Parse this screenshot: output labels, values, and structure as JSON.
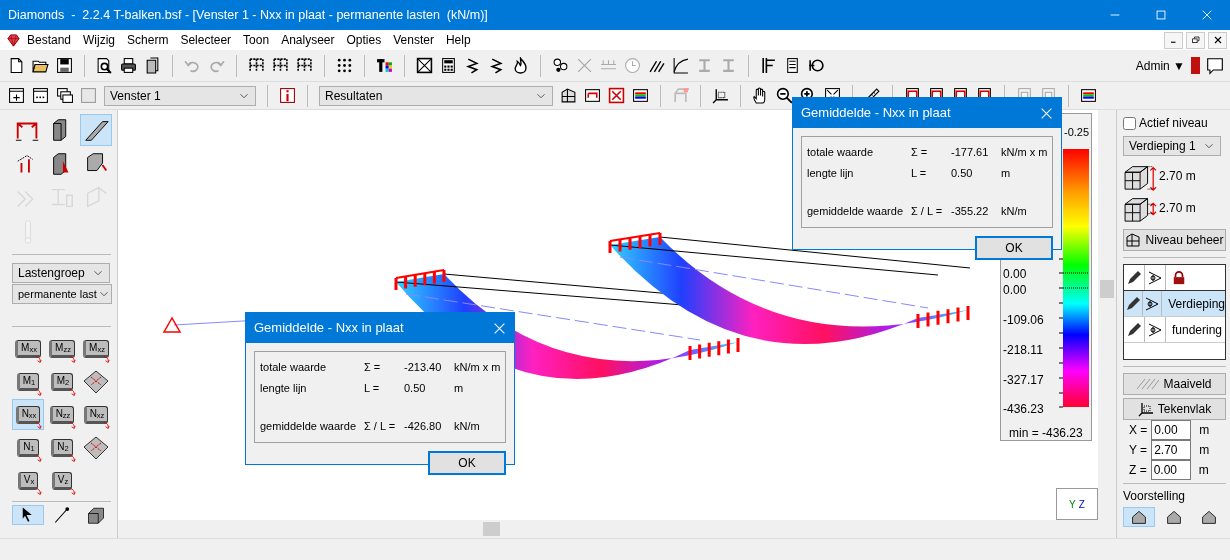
{
  "window": {
    "title": "Diamonds  -  2.2.4 T-balken.bsf - [Venster 1 - Nxx in plaat - permanente lasten  (kN/m)]"
  },
  "menu": [
    {
      "label": "Bestand"
    },
    {
      "label": "Wijzig"
    },
    {
      "label": "Scherm"
    },
    {
      "label": "Selecteer"
    },
    {
      "label": "Toon"
    },
    {
      "label": "Analyseer"
    },
    {
      "label": "Opties"
    },
    {
      "label": "Venster"
    },
    {
      "label": "Help"
    }
  ],
  "user": {
    "name": "Admin",
    "caret": "▼"
  },
  "toolbar": {
    "window_select": "Venster 1",
    "result_select": "Resultaten"
  },
  "left_panel": {
    "tools": [
      {
        "selected": false,
        "disabled": false
      },
      {
        "selected": false,
        "disabled": false
      },
      {
        "selected": true,
        "disabled": false
      },
      {
        "selected": false,
        "disabled": false
      },
      {
        "selected": false,
        "disabled": false
      },
      {
        "selected": false,
        "disabled": false
      },
      {
        "selected": false,
        "disabled": true
      },
      {
        "selected": false,
        "disabled": true
      },
      {
        "selected": false,
        "disabled": true
      },
      {
        "selected": false,
        "disabled": true
      }
    ],
    "load_type": "Lastengroep",
    "load_case": "permanente last",
    "plate_results": [
      {
        "kind": "label",
        "label": "M$_{xx}$",
        "selected": false
      },
      {
        "kind": "label",
        "label": "M$_{zz}$",
        "selected": false
      },
      {
        "kind": "label",
        "label": "M$_{xz}$",
        "selected": false
      },
      {
        "kind": "label",
        "label": "M$_{1}$",
        "selected": false
      },
      {
        "kind": "label",
        "label": "M$_{2}$",
        "selected": false
      },
      {
        "kind": "cross",
        "selected": false
      },
      {
        "kind": "label",
        "label": "N$_{xx}$",
        "selected": true
      },
      {
        "kind": "label",
        "label": "N$_{zz}$",
        "selected": false
      },
      {
        "kind": "label",
        "label": "N$_{xz}$",
        "selected": false
      },
      {
        "kind": "label",
        "label": "N$_{1}$",
        "selected": false
      },
      {
        "kind": "label",
        "label": "N$_{2}$",
        "selected": false
      },
      {
        "kind": "cross",
        "selected": false
      },
      {
        "kind": "label",
        "label": "V$_{x}$",
        "selected": false
      },
      {
        "kind": "label",
        "label": "V$_{z}$",
        "selected": false
      }
    ],
    "bottom_tools": [
      {
        "selected": true
      },
      {
        "selected": false
      },
      {
        "selected": false
      }
    ]
  },
  "legend": {
    "labels": [
      "-0.25",
      "0.00",
      "0.00",
      "-109.06",
      "-218.11",
      "-327.17",
      "-436.23"
    ],
    "min_label": "min = -436.23"
  },
  "axes": {
    "labels": [
      "Y",
      "Z"
    ]
  },
  "dialogs": [
    {
      "title": "Gemiddelde - Nxx in plaat",
      "ok": "OK",
      "rows": [
        {
          "label": "totale waarde",
          "symbol": "Σ =",
          "value": "-177.61",
          "unit": "kN/m x m"
        },
        {
          "label": "lengte lijn",
          "symbol": "L =",
          "value": "0.50",
          "unit": "m"
        },
        {
          "label": "gemiddelde waarde",
          "symbol": "Σ / L =",
          "value": "-355.22",
          "unit": "kN/m"
        }
      ]
    },
    {
      "title": "Gemiddelde - Nxx in plaat",
      "ok": "OK",
      "rows": [
        {
          "label": "totale waarde",
          "symbol": "Σ =",
          "value": "-213.40",
          "unit": "kN/m x m"
        },
        {
          "label": "lengte lijn",
          "symbol": "L =",
          "value": "0.50",
          "unit": "m"
        },
        {
          "label": "gemiddelde waarde",
          "symbol": "Σ / L =",
          "value": "-426.80",
          "unit": "kN/m"
        }
      ]
    }
  ],
  "right_panel": {
    "active_level": {
      "label": "Actief niveau",
      "checked": false
    },
    "level_select": "Verdieping 1",
    "level_heights": [
      {
        "value": "2.70 m"
      },
      {
        "value": "2.70 m"
      }
    ],
    "manage_button": "Niveau beheer",
    "layers": [
      {
        "name": "Verdieping",
        "selected": true
      },
      {
        "name": "fundering",
        "selected": false
      }
    ],
    "ground_button": "Maaiveld",
    "plane_button": "Tekenvlak",
    "coordinates": [
      {
        "axis": "X =",
        "value": "0.00",
        "unit": "m"
      },
      {
        "axis": "Y =",
        "value": "2.70",
        "unit": "m"
      },
      {
        "axis": "Z =",
        "value": "0.00",
        "unit": "m"
      }
    ],
    "view_label": "Voorstelling",
    "view_modes": [
      {
        "selected": true
      },
      {
        "selected": false
      },
      {
        "selected": false
      }
    ]
  }
}
